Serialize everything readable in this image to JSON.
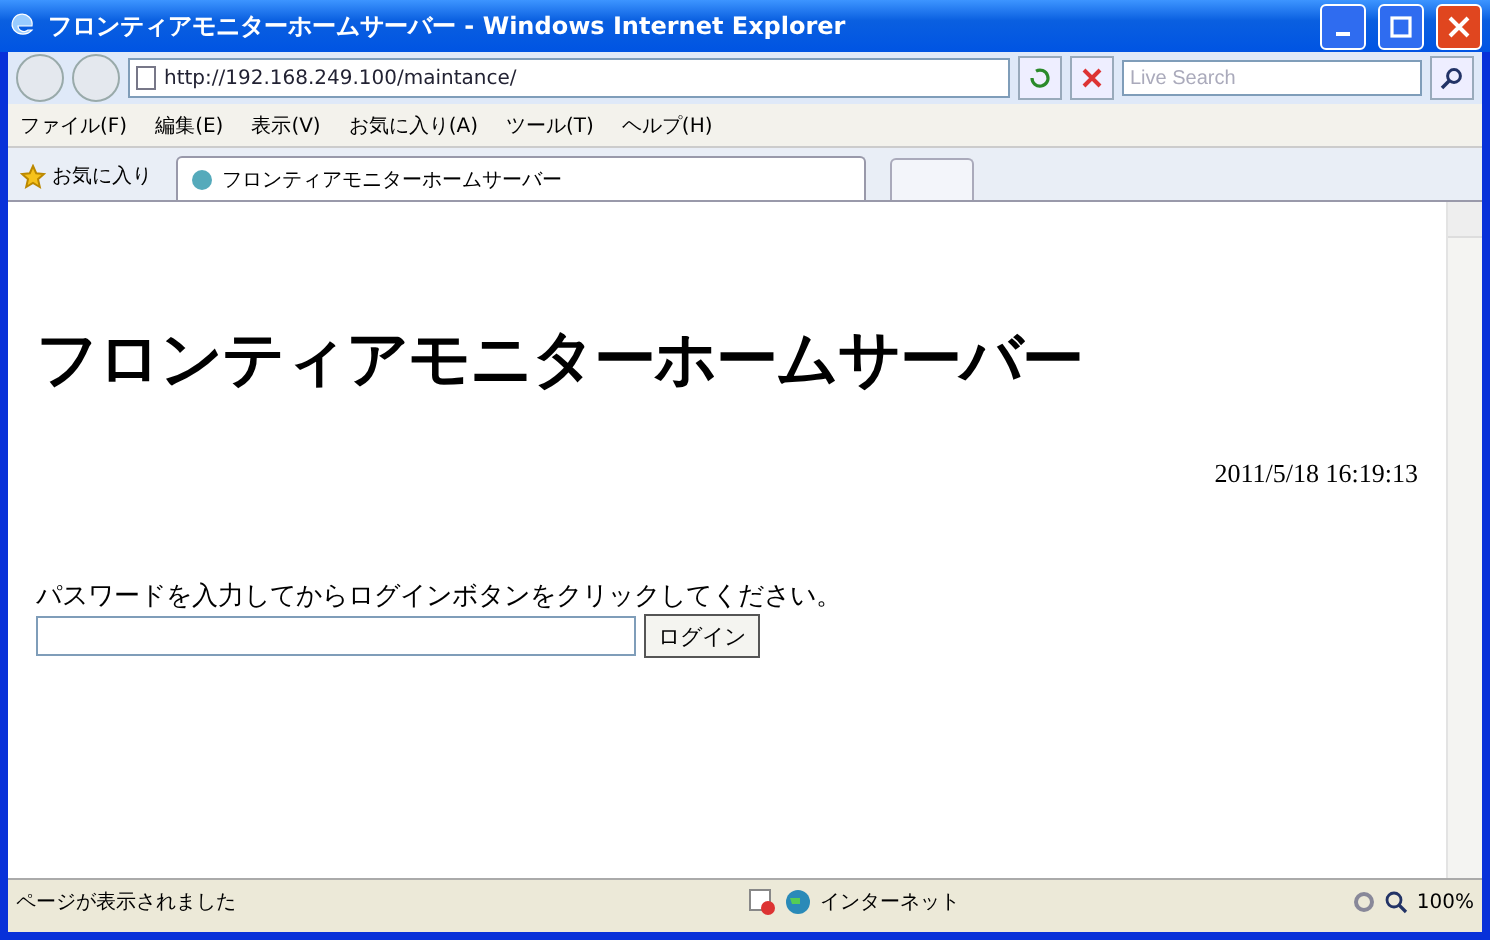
{
  "window": {
    "title": "フロンティアモニターホームサーバー - Windows Internet Explorer"
  },
  "address_bar": {
    "url": "http://192.168.249.100/maintance/"
  },
  "search": {
    "placeholder": "Live Search"
  },
  "menu": [
    "ファイル(F)",
    "編集(E)",
    "表示(V)",
    "お気に入り(A)",
    "ツール(T)",
    "ヘルプ(H)"
  ],
  "favorites": {
    "label": "お気に入り"
  },
  "tabs": [
    {
      "label": "フロンティアモニターホームサーバー",
      "selected": true
    }
  ],
  "page": {
    "heading": "フロンティアモニターホームサーバー",
    "timestamp": "2011/5/18 16:19:13",
    "instruction": "パスワードを入力してからログインボタンをクリックしてください。",
    "login_button": "ログイン"
  },
  "status_bar": {
    "message": "ページが表示されました",
    "zone": "インターネット",
    "zoom": "100%"
  }
}
